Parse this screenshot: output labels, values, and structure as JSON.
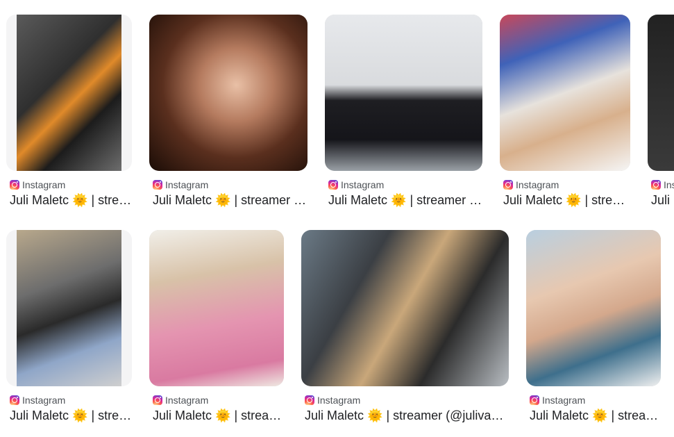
{
  "results": [
    {
      "source": "Instagram",
      "title": "Juli Maletc 🌞 | streamer (@julivanessa)",
      "photo": {
        "bg": "linear-gradient(135deg,#5a5a5a 0%,#2f2f2f 40%,#e08a2a 55%,#1c1c1c 70%,#6d6d6d 100%)"
      }
    },
    {
      "source": "Instagram",
      "title": "Juli Maletc 🌞 | streamer (@julivanessa)",
      "photo": {
        "bg": "radial-gradient(ellipse at 55% 45%,#e9c0a6 0%,#b57b5f 30%,#5a2f1e 60%,#1a0c06 100%)"
      }
    },
    {
      "source": "Instagram",
      "title": "Juli Maletc 🌞 | streamer (@julivanessa)",
      "photo": {
        "bg": "linear-gradient(180deg,#e7e9ec 0%,#d9dbde 45%,#1e1e22 55%,#15151a 80%,#9aa0a6 100%)"
      }
    },
    {
      "source": "Instagram",
      "title": "Juli Maletc 🌞 | streamer (@julivanessa)",
      "photo": {
        "bg": "linear-gradient(160deg,#c9485a 0%,#3f62b8 25%,#e7e2dc 50%,#d8b08c 70%,#f5f5f5 100%)"
      }
    },
    {
      "source": "Instagram",
      "title": "Juli Maletc 🌞 | streamer (@julivanessa)",
      "photo": {
        "bg": "linear-gradient(180deg,#222 0%,#3a3a3a 100%)"
      }
    },
    {
      "source": "Instagram",
      "title": "Juli Maletc 🌞 | streamer (@julivanessa)",
      "photo": {
        "bg": "linear-gradient(160deg,#b8a88c 0%,#6d6d6d 35%,#2a2a2a 55%,#8fa6c8 75%,#cfcfcf 100%)"
      }
    },
    {
      "source": "Instagram",
      "title": "Juli Maletc 🌞 | streamer (@julivanessa)",
      "photo": {
        "bg": "linear-gradient(170deg,#f1efe9 0%,#d8c2a8 30%,#e494b0 60%,#d97aa1 85%,#efe9e2 100%)"
      }
    },
    {
      "source": "Instagram",
      "title": "Juli Maletc 🌞 | streamer (@julivanessa)",
      "photo": {
        "bg": "linear-gradient(120deg,#6b7a86 0%,#3b3f44 30%,#c9a77a 50%,#2b2b2b 70%,#b9bec3 100%)"
      }
    },
    {
      "source": "Instagram",
      "title": "Juli Maletc 🌞 | streamer (@julivanessa)",
      "photo": {
        "bg": "linear-gradient(160deg,#b9cfe0 0%,#e7c8b0 35%,#d4a88c 55%,#3e6f8c 75%,#f0f0f0 100%)"
      }
    }
  ]
}
